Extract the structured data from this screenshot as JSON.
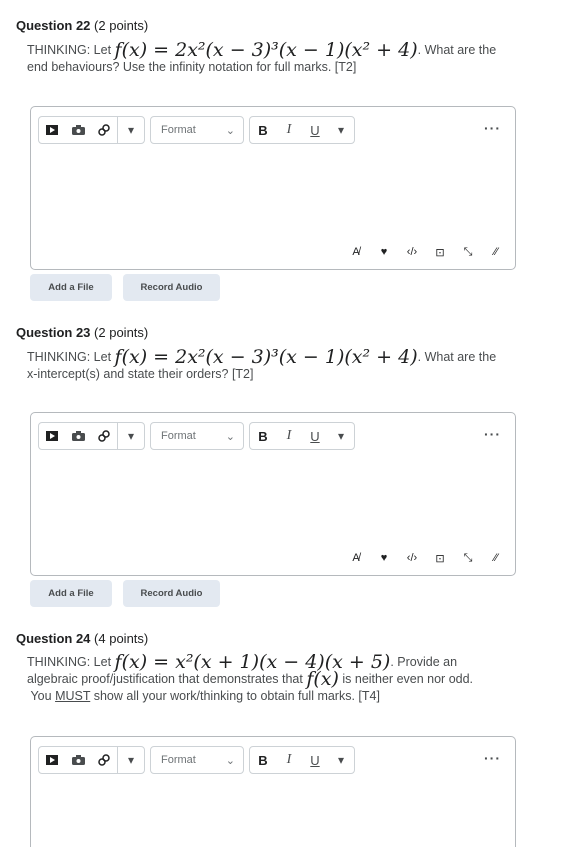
{
  "questions": [
    {
      "number_label": "Question 22",
      "points": "(2 points)",
      "prefix": "THINKING:  Let ",
      "math_fx": "f(x) = 2x²(x − 3)³(x − 1)(x² + 4)",
      "text_after": ". What are the",
      "text_line2": "end behaviours?  Use the infinity notation for full marks. [T2]"
    },
    {
      "number_label": "Question 23",
      "points": "(2 points)",
      "prefix": "THINKING:  Let ",
      "math_fx": "f(x) = 2x²(x − 3)³(x − 1)(x² + 4)",
      "text_after": ". What are the",
      "text_line2": "x-intercept(s) and state their orders? [T2]"
    },
    {
      "number_label": "Question 24",
      "points": "(4 points)",
      "prefix": "THINKING:  Let ",
      "math_fx": "f(x) = x²(x + 1)(x − 4)(x + 5)",
      "text_after": ".  Provide an",
      "text_line2a": "algebraic proof/justification that demonstrates that ",
      "text_line2b": "f(x)",
      "text_line2c": " is neither even nor odd.",
      "text_line3a": "You ",
      "text_line3b": "MUST",
      "text_line3c": " show all your work/thinking to obtain full marks.  [T4]"
    }
  ],
  "editor": {
    "format_label": "Format",
    "bold": "B",
    "italic": "I",
    "underline": "U",
    "more": "···",
    "icons": [
      "video-icon",
      "camera-icon",
      "link-icon",
      "dropdown-icon",
      "spellcheck-icon",
      "accessibility-icon",
      "source-code-icon",
      "preview-icon",
      "fullscreen-icon",
      "resize-icon"
    ]
  },
  "buttons": {
    "add_file": "Add a File",
    "record_audio": "Record Audio"
  }
}
